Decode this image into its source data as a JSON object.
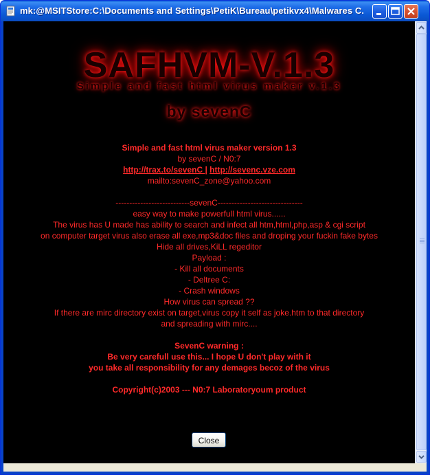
{
  "window": {
    "title": "mk:@MSITStore:C:\\Documents and Settings\\PetiK\\Bureau\\petikvx4\\Malwares C...",
    "icon": "html-help-icon",
    "controls": {
      "minimize": "minimize-icon",
      "maximize": "maximize-icon",
      "close": "close-icon"
    }
  },
  "banner": {
    "logo": "SAFHVM-V.1.3",
    "subtitle": "Simple and fast html virus maker v.1.3",
    "byline": "by sevenC"
  },
  "info": {
    "heading": "Simple and fast html virus maker version 1.3",
    "author": "by sevenC / N0:7",
    "link1": "http://trax.to/sevenC ",
    "link_sep": "|",
    "link2": "http://sevenc.vze.com",
    "mailto": "mailto:sevenC_zone@yahoo.com",
    "divider": "---------------------------sevenC-------------------------------"
  },
  "description": [
    "easy way to make powerfull html virus......",
    "The virus has U made has ability to search and infect all htm,html,php,asp & cgi script",
    "on computer target virus also erase all exe,mp3&doc files and droping your fuckin fake bytes",
    "Hide all drives,KiLL regeditor",
    "Payload :",
    "- Kill all documents",
    "- Deltree C:",
    "- Crash windows",
    "How virus can spread ??",
    "If there are mirc directory exist on target,virus copy it self as joke.htm to that directory",
    "and spreading with mirc...."
  ],
  "warning": {
    "heading": "SevenC warning :",
    "line1": "Be very carefull use this... I hope U don't play with it",
    "line2": "you take all responsibility for any demages becoz of the virus"
  },
  "copyright": "Copyright(c)2003 --- N0:7 Laboratoryoum product",
  "buttons": {
    "close": "Close"
  },
  "colors": {
    "text_red": "#ff2a2a",
    "background": "#000000",
    "titlebar_blue": "#0a58d4"
  }
}
